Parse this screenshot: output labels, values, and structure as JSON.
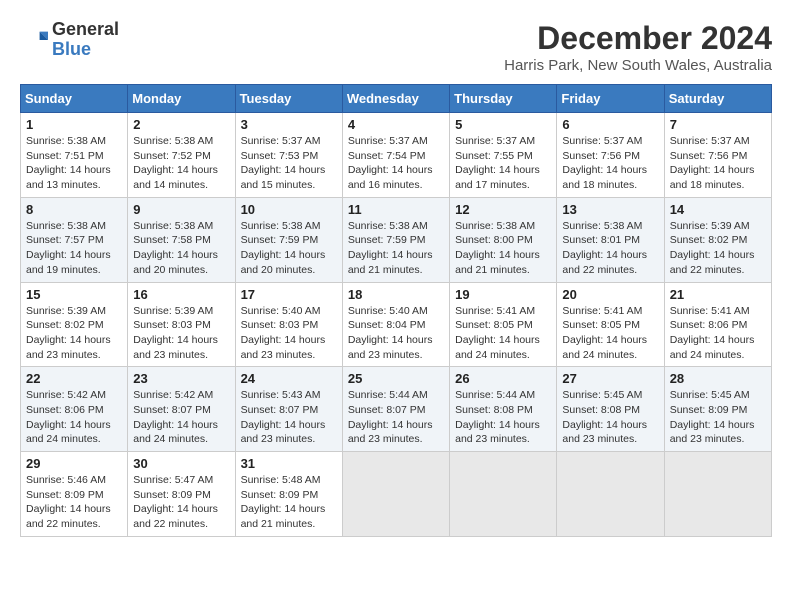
{
  "logo": {
    "general": "General",
    "blue": "Blue"
  },
  "header": {
    "month_year": "December 2024",
    "location": "Harris Park, New South Wales, Australia"
  },
  "weekdays": [
    "Sunday",
    "Monday",
    "Tuesday",
    "Wednesday",
    "Thursday",
    "Friday",
    "Saturday"
  ],
  "weeks": [
    [
      {
        "day": "1",
        "sunrise": "5:38 AM",
        "sunset": "7:51 PM",
        "daylight": "14 hours and 13 minutes."
      },
      {
        "day": "2",
        "sunrise": "5:38 AM",
        "sunset": "7:52 PM",
        "daylight": "14 hours and 14 minutes."
      },
      {
        "day": "3",
        "sunrise": "5:37 AM",
        "sunset": "7:53 PM",
        "daylight": "14 hours and 15 minutes."
      },
      {
        "day": "4",
        "sunrise": "5:37 AM",
        "sunset": "7:54 PM",
        "daylight": "14 hours and 16 minutes."
      },
      {
        "day": "5",
        "sunrise": "5:37 AM",
        "sunset": "7:55 PM",
        "daylight": "14 hours and 17 minutes."
      },
      {
        "day": "6",
        "sunrise": "5:37 AM",
        "sunset": "7:56 PM",
        "daylight": "14 hours and 18 minutes."
      },
      {
        "day": "7",
        "sunrise": "5:37 AM",
        "sunset": "7:56 PM",
        "daylight": "14 hours and 18 minutes."
      }
    ],
    [
      {
        "day": "8",
        "sunrise": "5:38 AM",
        "sunset": "7:57 PM",
        "daylight": "14 hours and 19 minutes."
      },
      {
        "day": "9",
        "sunrise": "5:38 AM",
        "sunset": "7:58 PM",
        "daylight": "14 hours and 20 minutes."
      },
      {
        "day": "10",
        "sunrise": "5:38 AM",
        "sunset": "7:59 PM",
        "daylight": "14 hours and 20 minutes."
      },
      {
        "day": "11",
        "sunrise": "5:38 AM",
        "sunset": "7:59 PM",
        "daylight": "14 hours and 21 minutes."
      },
      {
        "day": "12",
        "sunrise": "5:38 AM",
        "sunset": "8:00 PM",
        "daylight": "14 hours and 21 minutes."
      },
      {
        "day": "13",
        "sunrise": "5:38 AM",
        "sunset": "8:01 PM",
        "daylight": "14 hours and 22 minutes."
      },
      {
        "day": "14",
        "sunrise": "5:39 AM",
        "sunset": "8:02 PM",
        "daylight": "14 hours and 22 minutes."
      }
    ],
    [
      {
        "day": "15",
        "sunrise": "5:39 AM",
        "sunset": "8:02 PM",
        "daylight": "14 hours and 23 minutes."
      },
      {
        "day": "16",
        "sunrise": "5:39 AM",
        "sunset": "8:03 PM",
        "daylight": "14 hours and 23 minutes."
      },
      {
        "day": "17",
        "sunrise": "5:40 AM",
        "sunset": "8:03 PM",
        "daylight": "14 hours and 23 minutes."
      },
      {
        "day": "18",
        "sunrise": "5:40 AM",
        "sunset": "8:04 PM",
        "daylight": "14 hours and 23 minutes."
      },
      {
        "day": "19",
        "sunrise": "5:41 AM",
        "sunset": "8:05 PM",
        "daylight": "14 hours and 24 minutes."
      },
      {
        "day": "20",
        "sunrise": "5:41 AM",
        "sunset": "8:05 PM",
        "daylight": "14 hours and 24 minutes."
      },
      {
        "day": "21",
        "sunrise": "5:41 AM",
        "sunset": "8:06 PM",
        "daylight": "14 hours and 24 minutes."
      }
    ],
    [
      {
        "day": "22",
        "sunrise": "5:42 AM",
        "sunset": "8:06 PM",
        "daylight": "14 hours and 24 minutes."
      },
      {
        "day": "23",
        "sunrise": "5:42 AM",
        "sunset": "8:07 PM",
        "daylight": "14 hours and 24 minutes."
      },
      {
        "day": "24",
        "sunrise": "5:43 AM",
        "sunset": "8:07 PM",
        "daylight": "14 hours and 23 minutes."
      },
      {
        "day": "25",
        "sunrise": "5:44 AM",
        "sunset": "8:07 PM",
        "daylight": "14 hours and 23 minutes."
      },
      {
        "day": "26",
        "sunrise": "5:44 AM",
        "sunset": "8:08 PM",
        "daylight": "14 hours and 23 minutes."
      },
      {
        "day": "27",
        "sunrise": "5:45 AM",
        "sunset": "8:08 PM",
        "daylight": "14 hours and 23 minutes."
      },
      {
        "day": "28",
        "sunrise": "5:45 AM",
        "sunset": "8:09 PM",
        "daylight": "14 hours and 23 minutes."
      }
    ],
    [
      {
        "day": "29",
        "sunrise": "5:46 AM",
        "sunset": "8:09 PM",
        "daylight": "14 hours and 22 minutes."
      },
      {
        "day": "30",
        "sunrise": "5:47 AM",
        "sunset": "8:09 PM",
        "daylight": "14 hours and 22 minutes."
      },
      {
        "day": "31",
        "sunrise": "5:48 AM",
        "sunset": "8:09 PM",
        "daylight": "14 hours and 21 minutes."
      },
      null,
      null,
      null,
      null
    ]
  ],
  "labels": {
    "sunrise": "Sunrise:",
    "sunset": "Sunset:",
    "daylight": "Daylight:"
  }
}
